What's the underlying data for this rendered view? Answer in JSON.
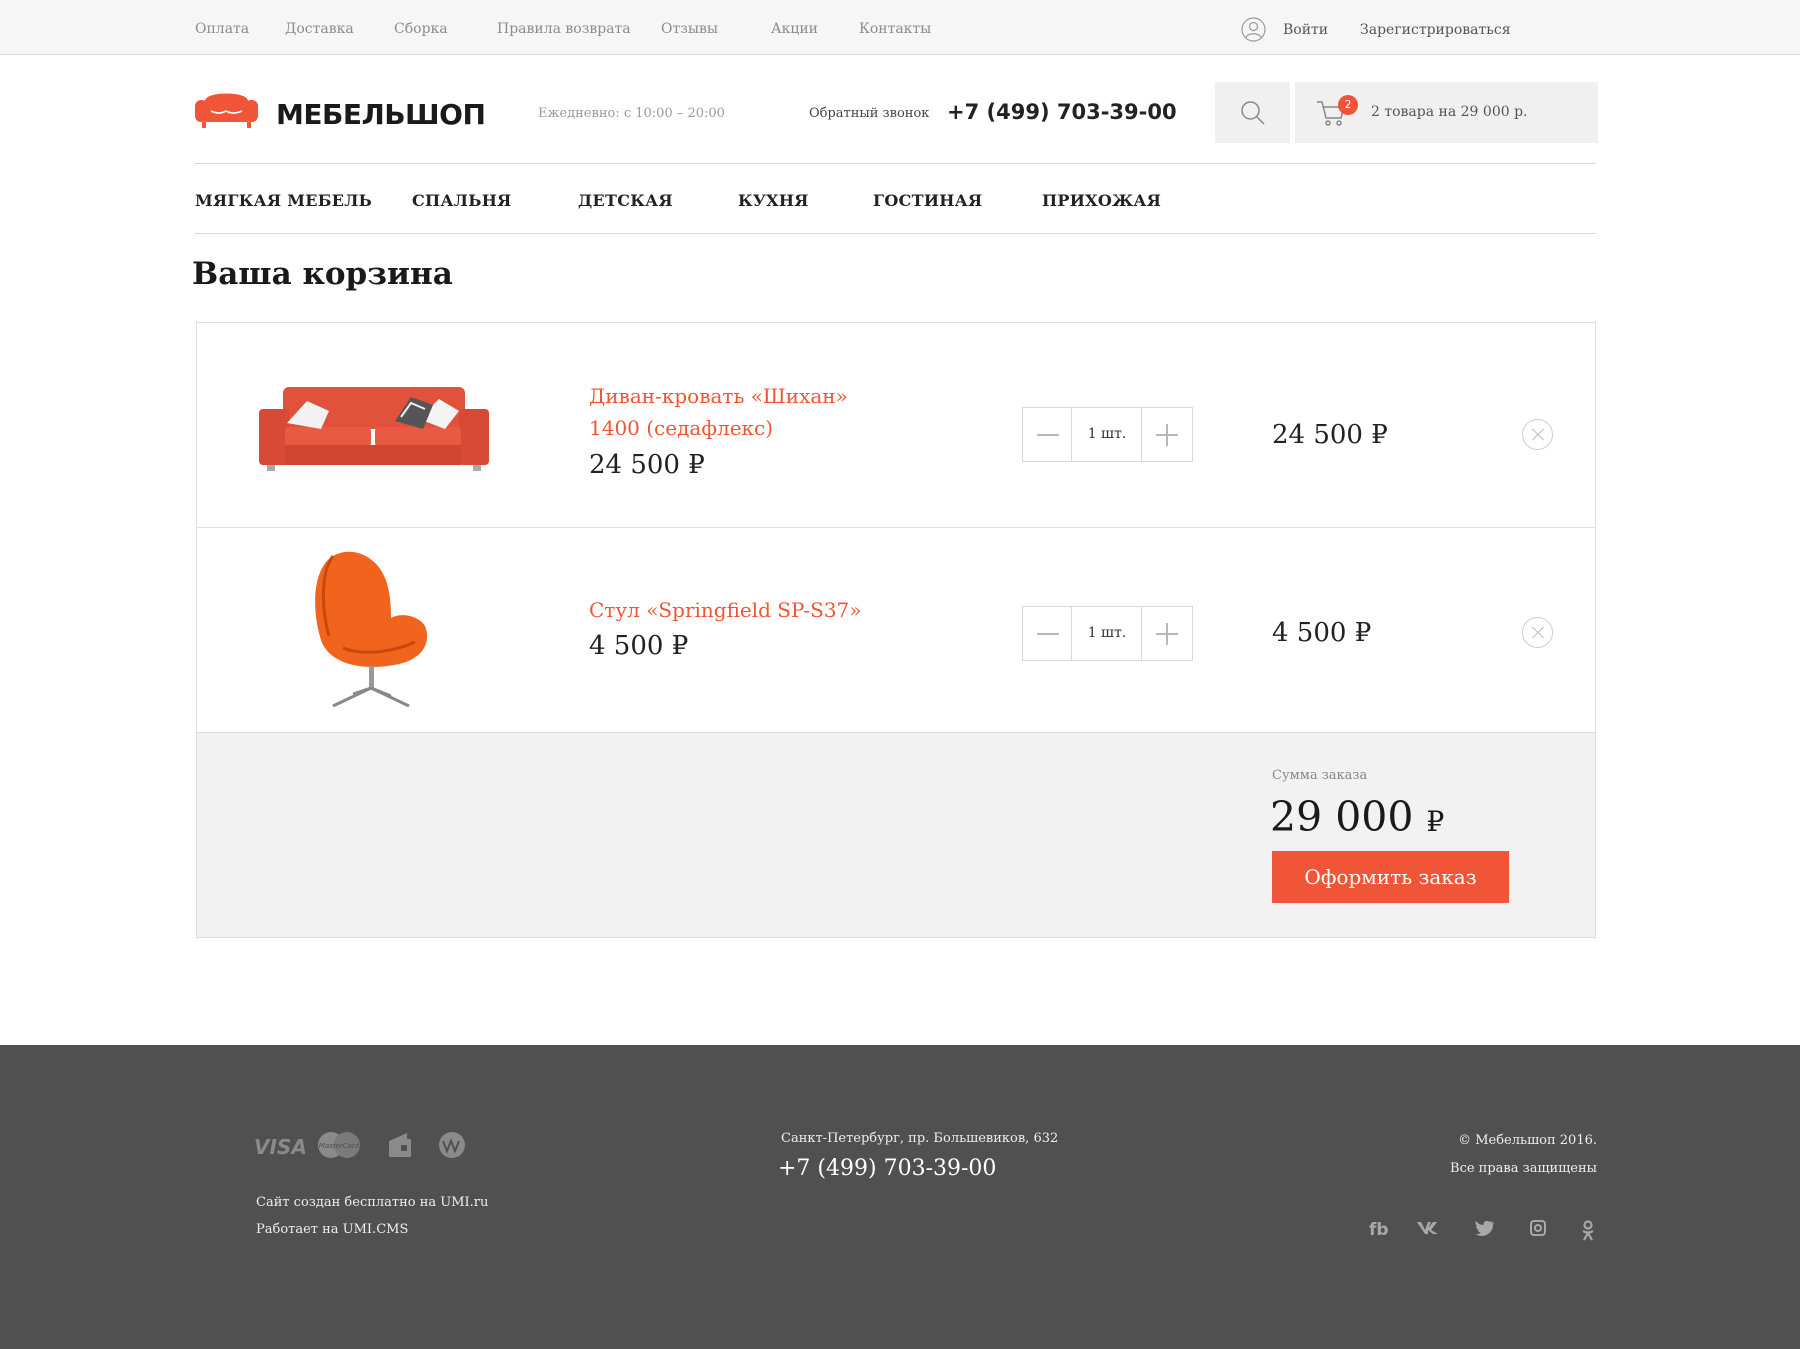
{
  "topbar": {
    "links": [
      "Оплата",
      "Доставка",
      "Сборка",
      "Правила возврата",
      "Отзывы",
      "Акции",
      "Контакты"
    ],
    "login": "Войти",
    "register": "Зарегистрироваться"
  },
  "header": {
    "logo": "МЕБЕЛЬШОП",
    "hours": "Ежедневно: с 10:00 – 20:00",
    "callback": "Обратный звонок",
    "phone": "+7 (499) 703-39-00",
    "cart_count": "2",
    "cart_summary": "2 товара на 29 000 р."
  },
  "nav": [
    "МЯГКАЯ МЕБЕЛЬ",
    "СПАЛЬНЯ",
    "ДЕТСКАЯ",
    "КУХНЯ",
    "ГОСТИНАЯ",
    "ПРИХОЖАЯ"
  ],
  "cart": {
    "title": "Ваша корзина",
    "items": [
      {
        "name": "Диван-кровать «Шихан» 1400 (седафлекс)",
        "price": "24 500 ₽",
        "qty": "1 шт.",
        "total": "24 500 ₽"
      },
      {
        "name": "Стул «Springfield SP-S37»",
        "price": "4 500 ₽",
        "qty": "1 шт.",
        "total": "4 500 ₽"
      }
    ],
    "sum_label": "Сумма заказа",
    "sum_value": "29 000",
    "currency": "₽",
    "checkout": "Оформить заказ"
  },
  "footer": {
    "visa": "VISA",
    "mastercard": "MasterCard",
    "credit_1": "Сайт создан бесплатно на UMI.ru",
    "credit_2": "Работает на UMI.CMS",
    "address": "Санкт-Петербург, пр. Большевиков, 632",
    "phone": "+7 (499) 703-39-00",
    "copyright": "© Мебельшоп 2016.",
    "rights": "Все права защищены",
    "social": [
      "fb",
      "vk",
      "twitter",
      "instagram",
      "odnoklassniki"
    ]
  },
  "colors": {
    "accent": "#f05537",
    "footer": "#505050"
  }
}
